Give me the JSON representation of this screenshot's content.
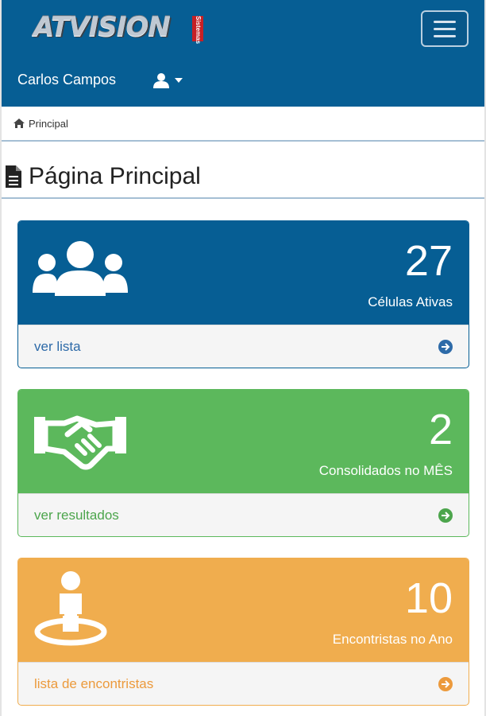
{
  "brand": {
    "logo_text": "ATVISION",
    "logo_tag": "Sistemas"
  },
  "navbar": {
    "user_name": "Carlos Campos",
    "user_icon": "user-icon",
    "menu_icon": "hamburger-icon"
  },
  "breadcrumb": {
    "icon": "home-icon",
    "label": "Principal"
  },
  "page": {
    "title": "Página Principal",
    "title_icon": "document-icon"
  },
  "panels": [
    {
      "icon": "users-group-icon",
      "value": "27",
      "caption": "Células Ativas",
      "link": "ver lista",
      "color": "#065e94"
    },
    {
      "icon": "handshake-icon",
      "value": "2",
      "caption": "Consolidados no MÊS",
      "link": "ver resultados",
      "color": "#5cb85c"
    },
    {
      "icon": "person-marker-icon",
      "value": "10",
      "caption": "Encontristas no Ano",
      "link": "lista de encontristas",
      "color": "#f0ad4e"
    }
  ]
}
